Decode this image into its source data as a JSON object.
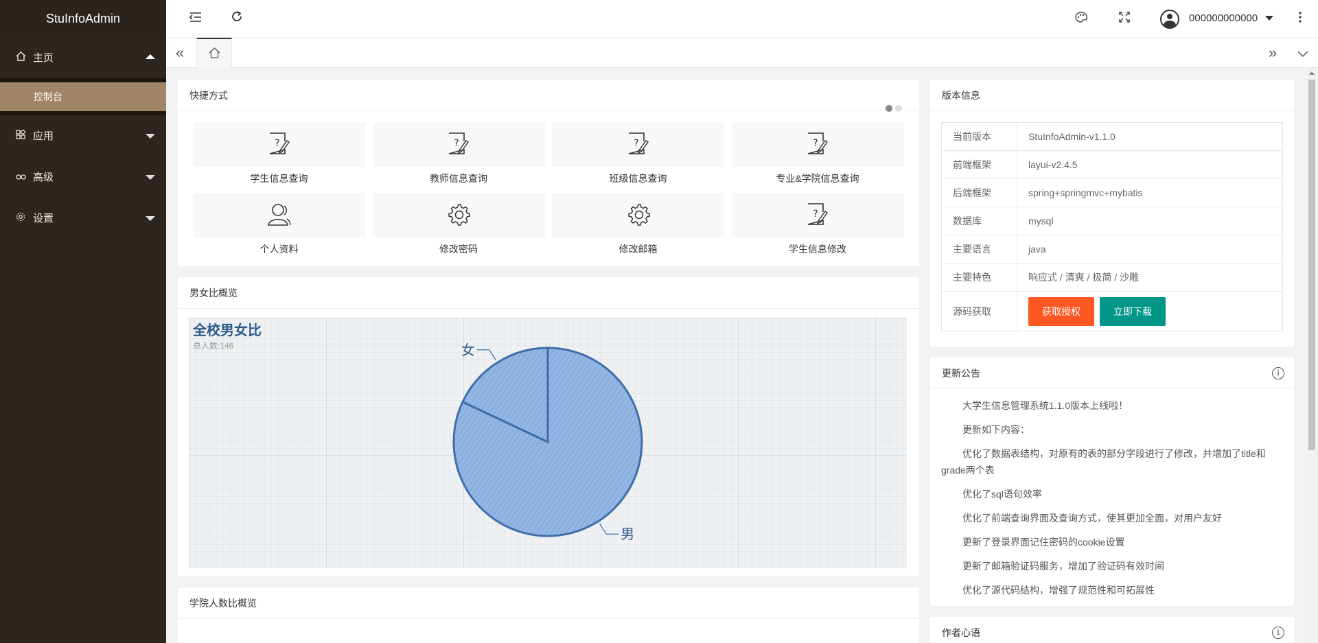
{
  "app": {
    "title": "StuInfoAdmin"
  },
  "sidebar": {
    "items": [
      {
        "label": "主页",
        "icon": "home-icon",
        "expanded": true
      },
      {
        "label": "应用",
        "icon": "app-icon",
        "expanded": false
      },
      {
        "label": "高级",
        "icon": "senior-icon",
        "expanded": false
      },
      {
        "label": "设置",
        "icon": "settings-icon",
        "expanded": false
      }
    ],
    "sub_item": "控制台"
  },
  "header": {
    "username": "000000000000"
  },
  "shortcuts": {
    "title": "快捷方式",
    "items": [
      {
        "label": "学生信息查询",
        "icon": "query-doc-icon"
      },
      {
        "label": "教师信息查询",
        "icon": "query-doc-icon"
      },
      {
        "label": "班级信息查询",
        "icon": "query-doc-icon"
      },
      {
        "label": "专业&学院信息查询",
        "icon": "query-doc-icon"
      },
      {
        "label": "个人资料",
        "icon": "user-icon"
      },
      {
        "label": "修改密码",
        "icon": "gear-icon"
      },
      {
        "label": "修改邮箱",
        "icon": "gear-icon"
      },
      {
        "label": "学生信息修改",
        "icon": "query-doc-icon"
      }
    ]
  },
  "gender_card": {
    "title": "男女比概览"
  },
  "chart_data": {
    "type": "pie",
    "title": "全校男女比",
    "subtitle": "总人数:146",
    "categories": [
      "男",
      "女"
    ],
    "values": [
      0.82,
      0.18
    ]
  },
  "college_card": {
    "title": "学院人数比概览"
  },
  "version": {
    "title": "版本信息",
    "rows": [
      {
        "k": "当前版本",
        "v": "StuInfoAdmin-v1.1.0"
      },
      {
        "k": "前端框架",
        "v": "layui-v2.4.5"
      },
      {
        "k": "后端框架",
        "v": "spring+springmvc+mybatis"
      },
      {
        "k": "数据库",
        "v": "mysql"
      },
      {
        "k": "主要语言",
        "v": "java"
      },
      {
        "k": "主要特色",
        "v": "响应式 / 清爽 / 极简 / 沙雕"
      }
    ],
    "source_label": "源码获取",
    "auth_button": "获取授权",
    "download_button": "立即下载"
  },
  "notice": {
    "title": "更新公告",
    "lines": [
      "大学生信息管理系统1.1.0版本上线啦！",
      "更新如下内容：",
      "优化了数据表结构，对原有的表的部分字段进行了修改，并增加了title和grade两个表",
      "优化了sql语句效率",
      "优化了前端查询界面及查询方式，使其更加全面，对用户友好",
      "更新了登录界面记住密码的cookie设置",
      "更新了邮箱验证码服务，增加了验证码有效时间",
      "优化了源代码结构，增强了规范性和可拓展性"
    ]
  },
  "author": {
    "title": "作者心语"
  }
}
